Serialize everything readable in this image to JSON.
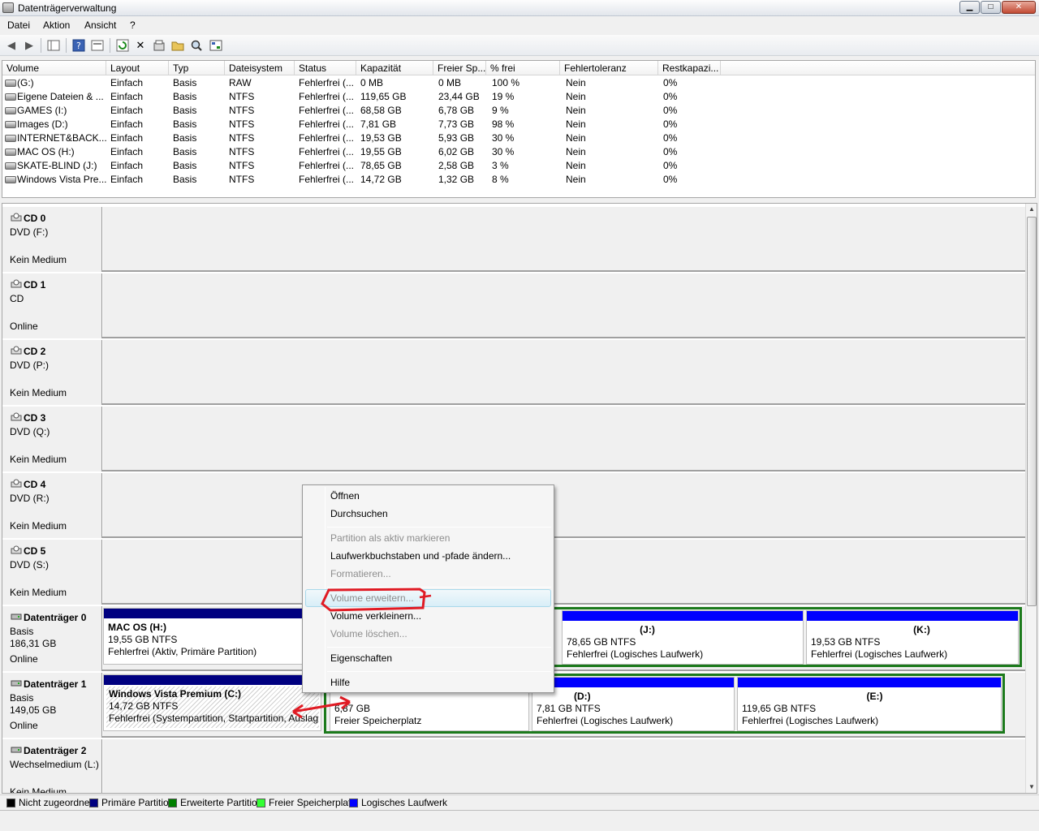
{
  "window": {
    "title": "Datenträgerverwaltung",
    "min": "▁",
    "max": "□",
    "close": "✕"
  },
  "menu": [
    "Datei",
    "Aktion",
    "Ansicht",
    "?"
  ],
  "volume_table": {
    "headers": [
      "Volume",
      "Layout",
      "Typ",
      "Dateisystem",
      "Status",
      "Kapazität",
      "Freier Sp...",
      "% frei",
      "Fehlertoleranz",
      "Restkapazi..."
    ],
    "rows": [
      [
        "(G:)",
        "Einfach",
        "Basis",
        "RAW",
        "Fehlerfrei (...",
        "0 MB",
        "0 MB",
        "100 %",
        "Nein",
        "0%"
      ],
      [
        "Eigene Dateien & ...",
        "Einfach",
        "Basis",
        "NTFS",
        "Fehlerfrei (...",
        "119,65 GB",
        "23,44 GB",
        "19 %",
        "Nein",
        "0%"
      ],
      [
        "GAMES (I:)",
        "Einfach",
        "Basis",
        "NTFS",
        "Fehlerfrei (...",
        "68,58 GB",
        "6,78 GB",
        "9 %",
        "Nein",
        "0%"
      ],
      [
        "Images (D:)",
        "Einfach",
        "Basis",
        "NTFS",
        "Fehlerfrei (...",
        "7,81 GB",
        "7,73 GB",
        "98 %",
        "Nein",
        "0%"
      ],
      [
        "INTERNET&BACK...",
        "Einfach",
        "Basis",
        "NTFS",
        "Fehlerfrei (...",
        "19,53 GB",
        "5,93 GB",
        "30 %",
        "Nein",
        "0%"
      ],
      [
        "MAC OS (H:)",
        "Einfach",
        "Basis",
        "NTFS",
        "Fehlerfrei (...",
        "19,55 GB",
        "6,02 GB",
        "30 %",
        "Nein",
        "0%"
      ],
      [
        "SKATE-BLIND (J:)",
        "Einfach",
        "Basis",
        "NTFS",
        "Fehlerfrei (...",
        "78,65 GB",
        "2,58 GB",
        "3 %",
        "Nein",
        "0%"
      ],
      [
        "Windows Vista Pre...",
        "Einfach",
        "Basis",
        "NTFS",
        "Fehlerfrei (...",
        "14,72 GB",
        "1,32 GB",
        "8 %",
        "Nein",
        "0%"
      ]
    ]
  },
  "disks": [
    {
      "name": "CD 0",
      "lines": [
        "DVD (F:)",
        "",
        "Kein Medium"
      ]
    },
    {
      "name": "CD 1",
      "lines": [
        "CD",
        "",
        "Online"
      ]
    },
    {
      "name": "CD 2",
      "lines": [
        "DVD (P:)",
        "",
        "Kein Medium"
      ]
    },
    {
      "name": "CD 3",
      "lines": [
        "DVD (Q:)",
        "",
        "Kein Medium"
      ]
    },
    {
      "name": "CD 4",
      "lines": [
        "DVD (R:)",
        "",
        "Kein Medium"
      ]
    },
    {
      "name": "CD 5",
      "lines": [
        "DVD (S:)",
        "",
        "Kein Medium"
      ]
    },
    {
      "name": "Datenträger 0",
      "lines": [
        "Basis",
        "186,31 GB",
        "Online"
      ]
    },
    {
      "name": "Datenträger 1",
      "lines": [
        "Basis",
        "149,05 GB",
        "Online"
      ]
    },
    {
      "name": "Datenträger 2",
      "lines": [
        "Wechselmedium (L:)",
        "",
        "Kein Medium"
      ]
    }
  ],
  "disk0_parts": [
    {
      "title": "MAC OS  (H:)",
      "size": "19,55 GB NTFS",
      "status": "Fehlerfrei (Aktiv, Primäre Partition)"
    },
    {
      "title": "(J:)",
      "size": "78,65 GB NTFS",
      "status": "Fehlerfrei (Logisches Laufwerk)"
    },
    {
      "title": "(K:)",
      "size": "19,53 GB NTFS",
      "status": "Fehlerfrei (Logisches Laufwerk)"
    }
  ],
  "disk1_parts": [
    {
      "title": "Windows Vista Premium  (C:)",
      "size": "14,72 GB NTFS",
      "status": "Fehlerfrei (Systempartition, Startpartition, Auslag"
    },
    {
      "title": "",
      "size": "6,87 GB",
      "status": "Freier Speicherplatz"
    },
    {
      "title": "(D:)",
      "size": "7,81 GB NTFS",
      "status": "Fehlerfrei (Logisches Laufwerk)"
    },
    {
      "title": "(E:)",
      "size": "119,65 GB NTFS",
      "status": "Fehlerfrei (Logisches Laufwerk)"
    }
  ],
  "legend": [
    {
      "label": "Nicht zugeordnet",
      "color": "#000000"
    },
    {
      "label": "Primäre Partition",
      "color": "#000080"
    },
    {
      "label": "Erweiterte Partition",
      "color": "#008000"
    },
    {
      "label": "Freier Speicherplatz",
      "color": "#33ff33"
    },
    {
      "label": "Logisches Laufwerk",
      "color": "#0000ff"
    }
  ],
  "context_menu": {
    "open": "Öffnen",
    "explore": "Durchsuchen",
    "mark_active": "Partition als aktiv markieren",
    "change_letter": "Laufwerkbuchstaben und -pfade ändern...",
    "format": "Formatieren...",
    "extend": "Volume erweitern...",
    "shrink": "Volume verkleinern...",
    "delete": "Volume löschen...",
    "properties": "Eigenschaften",
    "help": "Hilfe"
  },
  "colors": {
    "primary_bar": "#000080",
    "logical_bar": "#0000ff",
    "extended_frame": "#1c7a1c",
    "annotation": "#e01b24"
  }
}
